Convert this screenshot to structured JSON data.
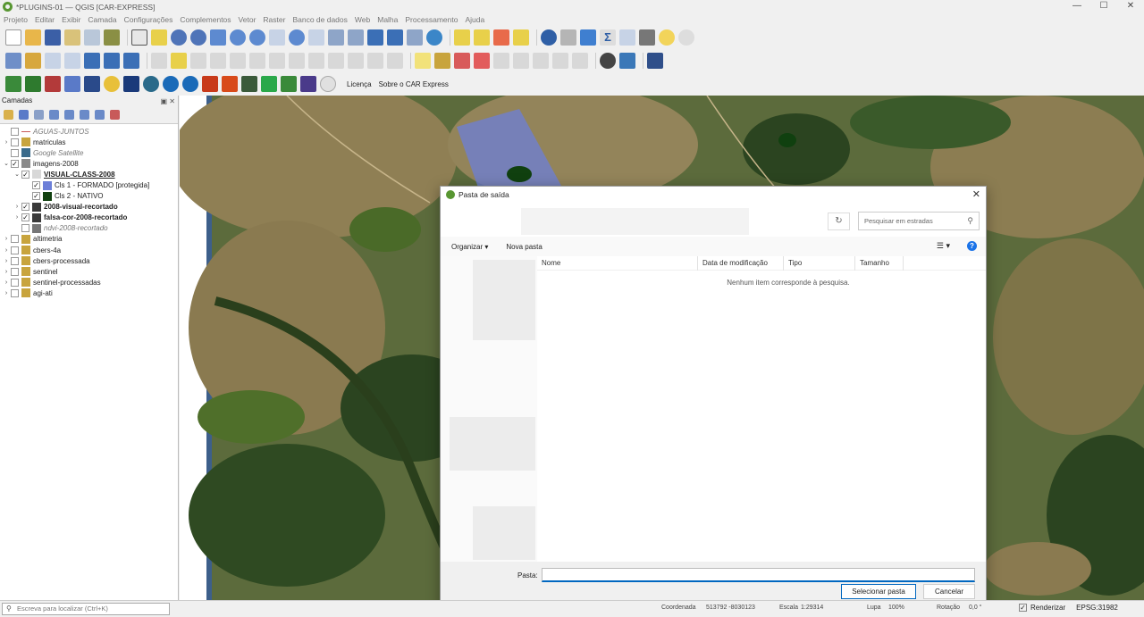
{
  "window": {
    "title": "*PLUGINS-01 — QGIS [CAR-EXPRESS]",
    "min": "—",
    "max": "☐",
    "close": "✕"
  },
  "menu": [
    "Projeto",
    "Editar",
    "Exibir",
    "Camada",
    "Configurações",
    "Complementos",
    "Vetor",
    "Raster",
    "Banco de dados",
    "Web",
    "Malha",
    "Processamento",
    "Ajuda"
  ],
  "plugin_toolbar": {
    "licenca": "Licença",
    "sobre": "Sobre o CAR Express"
  },
  "layers_panel": {
    "title": "Camadas",
    "buttons": "▣ ✕"
  },
  "layers": [
    {
      "name": "AGUAS-JUNTOS",
      "arrow": "",
      "checked": "",
      "style": "italic",
      "indent": 0
    },
    {
      "name": "matriculas",
      "arrow": "›",
      "checked": "",
      "style": "normal",
      "indent": 0
    },
    {
      "name": "Google Satellite",
      "arrow": "",
      "checked": "",
      "style": "italic",
      "indent": 0
    },
    {
      "name": "imagens-2008",
      "arrow": "⌄",
      "checked": "✓",
      "style": "normal",
      "indent": 0
    },
    {
      "name": "VISUAL-CLASS-2008",
      "arrow": "⌄",
      "checked": "✓",
      "style": "bold-underline",
      "indent": 1
    },
    {
      "name": "Cls 1 - FORMADO [protegida]",
      "arrow": "",
      "checked": "✓",
      "style": "normal",
      "indent": 2
    },
    {
      "name": "Cls 2 - NATIVO",
      "arrow": "",
      "checked": "✓",
      "style": "normal",
      "indent": 2
    },
    {
      "name": "2008-visual-recortado",
      "arrow": "›",
      "checked": "✓",
      "style": "bold",
      "indent": 1
    },
    {
      "name": "falsa-cor-2008-recortado",
      "arrow": "›",
      "checked": "✓",
      "style": "bold",
      "indent": 1
    },
    {
      "name": "ndvi-2008-recortado",
      "arrow": "",
      "checked": "",
      "style": "italic",
      "indent": 1
    },
    {
      "name": "altimetria",
      "arrow": "›",
      "checked": "",
      "style": "normal",
      "indent": 0
    },
    {
      "name": "cbers-4a",
      "arrow": "›",
      "checked": "",
      "style": "normal",
      "indent": 0
    },
    {
      "name": "cbers-processada",
      "arrow": "›",
      "checked": "",
      "style": "normal",
      "indent": 0
    },
    {
      "name": "sentinel",
      "arrow": "›",
      "checked": "",
      "style": "normal",
      "indent": 0
    },
    {
      "name": "sentinel-processadas",
      "arrow": "›",
      "checked": "",
      "style": "normal",
      "indent": 0
    },
    {
      "name": "agi-ati",
      "arrow": "›",
      "checked": "",
      "style": "normal",
      "indent": 0
    }
  ],
  "dialog": {
    "title": "Pasta de saída",
    "close": "✕",
    "refresh": "↻",
    "search_placeholder": "Pesquisar em estradas",
    "organize": "Organizar ▾",
    "new_folder": "Nova pasta",
    "view_toggle": "☰ ▾",
    "help": "?",
    "columns": [
      "Nome",
      "Data de modificação",
      "Tipo",
      "Tamanho"
    ],
    "empty_message": "Nenhum item corresponde à pesquisa.",
    "folder_label": "Pasta:",
    "folder_value": "",
    "select_button": "Selecionar pasta",
    "cancel_button": "Cancelar"
  },
  "status": {
    "locator_placeholder": "Escreva para localizar (Ctrl+K)",
    "coordinate_label": "Coordenada",
    "coordinate_value": "513792 -8030123",
    "scale_label": "Escala",
    "scale_value": "1:29314",
    "zoom_label": "Lupa",
    "zoom_value": "100%",
    "rotation_label": "Rotação",
    "rotation_value": "0,0 °",
    "render_label": "Renderizar",
    "render_checked": "✓",
    "crs": "EPSG:31982"
  },
  "colors": {
    "class1": "#6c7fd8",
    "class2": "#10400f",
    "accent": "#0067c0",
    "qgis_green": "#589632"
  }
}
